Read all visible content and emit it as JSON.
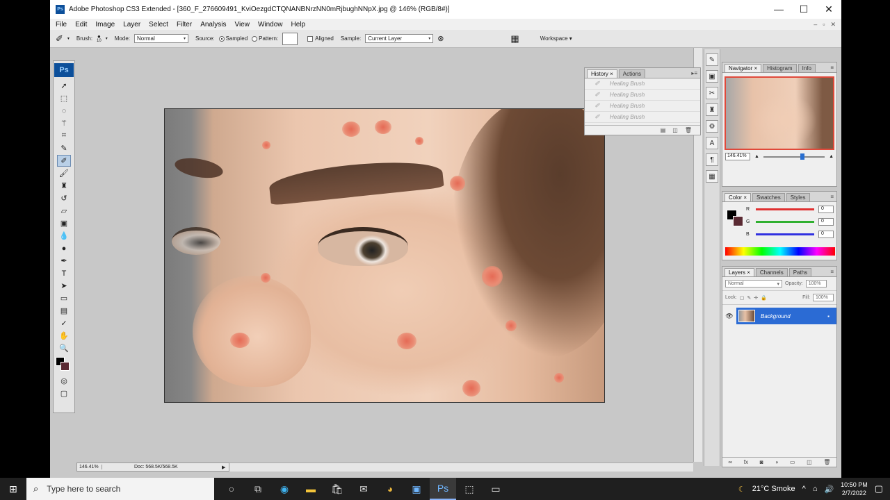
{
  "window": {
    "title": "Adobe Photoshop CS3 Extended - [360_F_276609491_KviOezgdCTQNANBNrzNN0mRjbughNNpX.jpg @ 146% (RGB/8#)]",
    "ps_badge": "Ps",
    "minimize": "—",
    "maximize": "☐",
    "close": "✕"
  },
  "menu": {
    "items": [
      "File",
      "Edit",
      "Image",
      "Layer",
      "Select",
      "Filter",
      "Analysis",
      "View",
      "Window",
      "Help"
    ],
    "doc_controls": [
      "–",
      "▫",
      "✕"
    ]
  },
  "options": {
    "brush_label": "Brush:",
    "brush_size": "10",
    "mode_label": "Mode:",
    "mode_value": "Normal",
    "source_label": "Source:",
    "sampled_label": "Sampled",
    "pattern_label": "Pattern:",
    "aligned_label": "Aligned",
    "sample_label": "Sample:",
    "sample_value": "Current Layer",
    "workspace_label": "Workspace ▾"
  },
  "toolbox": {
    "logo": "Ps",
    "tools": [
      {
        "name": "move-tool",
        "glyph": "➚"
      },
      {
        "name": "marquee-tool",
        "glyph": "⬚"
      },
      {
        "name": "lasso-tool",
        "glyph": "◌"
      },
      {
        "name": "magic-wand-tool",
        "glyph": "⚚"
      },
      {
        "name": "crop-tool",
        "glyph": "⌗"
      },
      {
        "name": "eyedropper-tool",
        "glyph": "✎"
      },
      {
        "name": "healing-brush-tool",
        "glyph": "✐",
        "active": true
      },
      {
        "name": "brush-tool",
        "glyph": "🖌"
      },
      {
        "name": "clone-stamp-tool",
        "glyph": "♜"
      },
      {
        "name": "history-brush-tool",
        "glyph": "↺"
      },
      {
        "name": "eraser-tool",
        "glyph": "▱"
      },
      {
        "name": "gradient-tool",
        "glyph": "▣"
      },
      {
        "name": "blur-tool",
        "glyph": "💧"
      },
      {
        "name": "dodge-tool",
        "glyph": "●"
      },
      {
        "name": "pen-tool",
        "glyph": "✒"
      },
      {
        "name": "type-tool",
        "glyph": "T"
      },
      {
        "name": "path-selection-tool",
        "glyph": "➤"
      },
      {
        "name": "shape-tool",
        "glyph": "▭"
      },
      {
        "name": "notes-tool",
        "glyph": "▤"
      },
      {
        "name": "eyedropper2-tool",
        "glyph": "✓"
      },
      {
        "name": "hand-tool",
        "glyph": "✋"
      },
      {
        "name": "zoom-tool",
        "glyph": "🔍"
      }
    ]
  },
  "history": {
    "tabs": [
      "History ×",
      "Actions"
    ],
    "items": [
      "Healing Brush",
      "Healing Brush",
      "Healing Brush",
      "Healing Brush"
    ]
  },
  "navigator": {
    "tabs": [
      "Navigator ×",
      "Histogram",
      "Info"
    ],
    "zoom": "146.41%"
  },
  "color": {
    "tabs": [
      "Color ×",
      "Swatches",
      "Styles"
    ],
    "channels": [
      {
        "label": "R",
        "value": "0",
        "color": "#e03030"
      },
      {
        "label": "G",
        "value": "0",
        "color": "#30b030"
      },
      {
        "label": "B",
        "value": "0",
        "color": "#3030e0"
      }
    ]
  },
  "layers": {
    "tabs": [
      "Layers ×",
      "Channels",
      "Paths"
    ],
    "blend_mode": "Normal",
    "opacity_label": "Opacity:",
    "opacity_value": "100%",
    "lock_label": "Lock:",
    "fill_label": "Fill:",
    "fill_value": "100%",
    "layer_name": "Background"
  },
  "status": {
    "zoom": "146.41%",
    "doc": "Doc: 568.5K/568.5K"
  },
  "taskbar": {
    "search_placeholder": "Type here to search",
    "weather": "21°C Smoke",
    "time": "10:50 PM",
    "date": "2/7/2022"
  }
}
